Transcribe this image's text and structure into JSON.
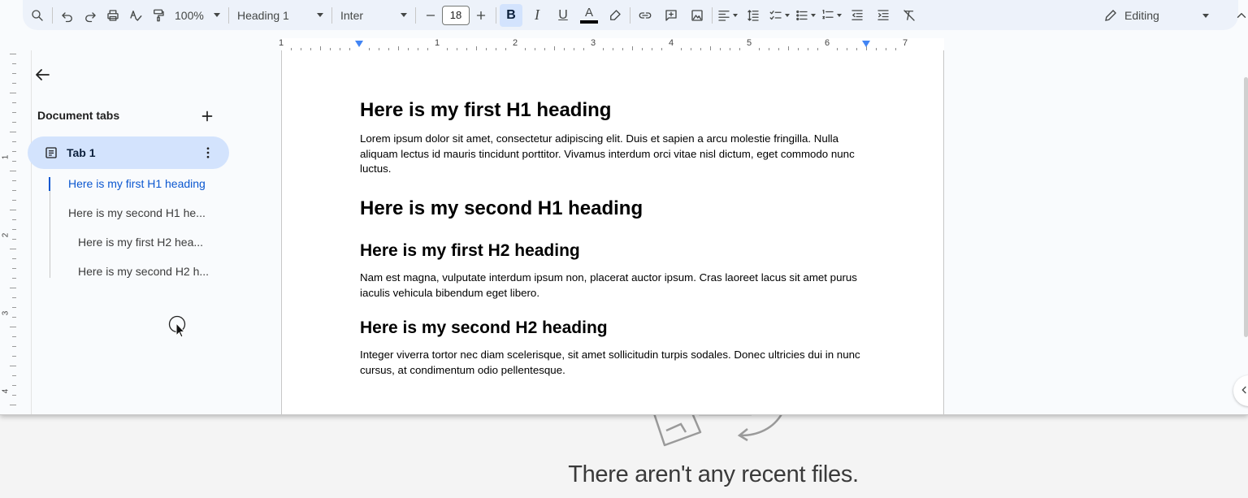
{
  "toolbar": {
    "zoom": "100%",
    "style": "Heading 1",
    "font": "Inter",
    "font_size": "18",
    "mode": "Editing"
  },
  "ruler": {
    "numbers": [
      "1",
      "1",
      "2",
      "3",
      "4",
      "5",
      "6",
      "7"
    ]
  },
  "vruler": {
    "numbers": [
      "1",
      "2",
      "3",
      "4"
    ]
  },
  "sidebar": {
    "title": "Document tabs",
    "tab": {
      "label": "Tab 1"
    },
    "outline": [
      {
        "label": "Here is my first H1 heading",
        "active": true
      },
      {
        "label": "Here is my second H1 he...",
        "active": false
      },
      {
        "label": "Here is my first H2 hea...",
        "active": false
      },
      {
        "label": "Here is my second H2 h...",
        "active": false
      }
    ]
  },
  "document": {
    "h1_first": "Here is my first H1 heading",
    "p1": "Lorem ipsum dolor sit amet, consectetur adipiscing elit. Duis et sapien a arcu molestie fringilla. Nulla aliquam lectus id mauris tincidunt porttitor. Vivamus interdum orci vitae nisl dictum, eget commodo nunc luctus.",
    "h1_second": "Here is my second H1 heading",
    "h2_first": "Here is my first H2 heading",
    "p2": "Nam est magna, vulputate interdum ipsum non, placerat auctor ipsum. Cras laoreet lacus sit amet purus iaculis vehicula bibendum eget libero.",
    "h2_second": "Here is my second H2 heading",
    "p3": "Integer viverra tortor nec diam scelerisque, sit amet sollicitudin turpis sodales. Donec ultricies dui in nunc cursus, at condimentum odio pellentesque."
  },
  "background": {
    "empty_message": "There aren't any recent files."
  },
  "colors": {
    "accent": "#0b57d0",
    "selected_tab": "#d3e3fd",
    "toolbar_bg": "#edf2fa"
  },
  "icons": [
    "search-icon",
    "undo-icon",
    "redo-icon",
    "print-icon",
    "spellcheck-icon",
    "paint-format-icon",
    "bold-icon",
    "italic-icon",
    "underline-icon",
    "text-color-icon",
    "highlight-icon",
    "link-icon",
    "comment-icon",
    "image-icon",
    "align-icon",
    "line-spacing-icon",
    "checklist-icon",
    "bullet-list-icon",
    "numbered-list-icon",
    "indent-decrease-icon",
    "indent-increase-icon",
    "clear-format-icon",
    "pencil-icon",
    "chevron-up-icon",
    "arrow-back-icon",
    "plus-icon",
    "document-icon",
    "more-vert-icon"
  ]
}
